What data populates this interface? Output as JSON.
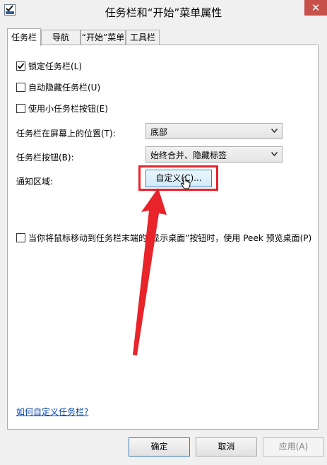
{
  "window": {
    "title": "任务栏和“开始”菜单属性",
    "close_glyph": "✕"
  },
  "tabs": [
    {
      "label": "任务栏",
      "active": true
    },
    {
      "label": "导航",
      "active": false
    },
    {
      "label": "“开始”菜单",
      "active": false
    },
    {
      "label": "工具栏",
      "active": false
    }
  ],
  "options": {
    "lock_taskbar": {
      "label": "锁定任务栏(L)",
      "checked": true
    },
    "auto_hide": {
      "label": "自动隐藏任务栏(U)",
      "checked": false
    },
    "small_buttons": {
      "label": "使用小任务栏按钮(E)",
      "checked": false
    }
  },
  "position": {
    "label": "任务栏在屏幕上的位置(T):",
    "value": "底部"
  },
  "buttons_mode": {
    "label": "任务栏按钮(B):",
    "value": "始终合并、隐藏标签"
  },
  "notification": {
    "label": "通知区域:",
    "customize_label": "自定义(C)..."
  },
  "peek": {
    "label": "当你将鼠标移动到任务栏末端的“显示桌面”按钮时，使用 Peek 预览桌面(P)",
    "checked": false
  },
  "help_link": "如何自定义任务栏?",
  "footer": {
    "ok": "确定",
    "cancel": "取消",
    "apply": "应用(A)"
  },
  "colors": {
    "annotation_red": "#e8232a",
    "close_button": "#c7504a",
    "link": "#0645ad"
  }
}
